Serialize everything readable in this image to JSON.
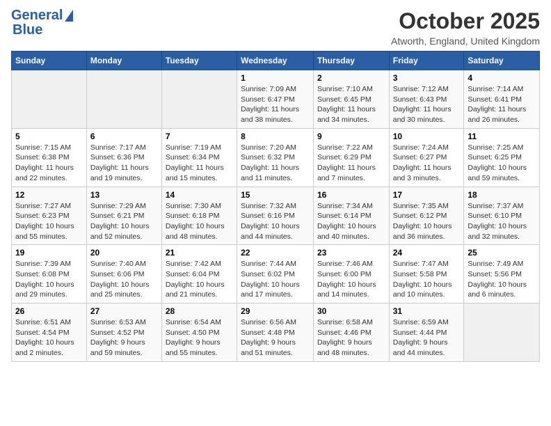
{
  "header": {
    "logo_general": "General",
    "logo_blue": "Blue",
    "month_title": "October 2025",
    "location": "Atworth, England, United Kingdom"
  },
  "weekdays": [
    "Sunday",
    "Monday",
    "Tuesday",
    "Wednesday",
    "Thursday",
    "Friday",
    "Saturday"
  ],
  "weeks": [
    [
      {
        "day": "",
        "info": ""
      },
      {
        "day": "",
        "info": ""
      },
      {
        "day": "",
        "info": ""
      },
      {
        "day": "1",
        "info": "Sunrise: 7:09 AM\nSunset: 6:47 PM\nDaylight: 11 hours\nand 38 minutes."
      },
      {
        "day": "2",
        "info": "Sunrise: 7:10 AM\nSunset: 6:45 PM\nDaylight: 11 hours\nand 34 minutes."
      },
      {
        "day": "3",
        "info": "Sunrise: 7:12 AM\nSunset: 6:43 PM\nDaylight: 11 hours\nand 30 minutes."
      },
      {
        "day": "4",
        "info": "Sunrise: 7:14 AM\nSunset: 6:41 PM\nDaylight: 11 hours\nand 26 minutes."
      }
    ],
    [
      {
        "day": "5",
        "info": "Sunrise: 7:15 AM\nSunset: 6:38 PM\nDaylight: 11 hours\nand 22 minutes."
      },
      {
        "day": "6",
        "info": "Sunrise: 7:17 AM\nSunset: 6:36 PM\nDaylight: 11 hours\nand 19 minutes."
      },
      {
        "day": "7",
        "info": "Sunrise: 7:19 AM\nSunset: 6:34 PM\nDaylight: 11 hours\nand 15 minutes."
      },
      {
        "day": "8",
        "info": "Sunrise: 7:20 AM\nSunset: 6:32 PM\nDaylight: 11 hours\nand 11 minutes."
      },
      {
        "day": "9",
        "info": "Sunrise: 7:22 AM\nSunset: 6:29 PM\nDaylight: 11 hours\nand 7 minutes."
      },
      {
        "day": "10",
        "info": "Sunrise: 7:24 AM\nSunset: 6:27 PM\nDaylight: 11 hours\nand 3 minutes."
      },
      {
        "day": "11",
        "info": "Sunrise: 7:25 AM\nSunset: 6:25 PM\nDaylight: 10 hours\nand 59 minutes."
      }
    ],
    [
      {
        "day": "12",
        "info": "Sunrise: 7:27 AM\nSunset: 6:23 PM\nDaylight: 10 hours\nand 55 minutes."
      },
      {
        "day": "13",
        "info": "Sunrise: 7:29 AM\nSunset: 6:21 PM\nDaylight: 10 hours\nand 52 minutes."
      },
      {
        "day": "14",
        "info": "Sunrise: 7:30 AM\nSunset: 6:18 PM\nDaylight: 10 hours\nand 48 minutes."
      },
      {
        "day": "15",
        "info": "Sunrise: 7:32 AM\nSunset: 6:16 PM\nDaylight: 10 hours\nand 44 minutes."
      },
      {
        "day": "16",
        "info": "Sunrise: 7:34 AM\nSunset: 6:14 PM\nDaylight: 10 hours\nand 40 minutes."
      },
      {
        "day": "17",
        "info": "Sunrise: 7:35 AM\nSunset: 6:12 PM\nDaylight: 10 hours\nand 36 minutes."
      },
      {
        "day": "18",
        "info": "Sunrise: 7:37 AM\nSunset: 6:10 PM\nDaylight: 10 hours\nand 32 minutes."
      }
    ],
    [
      {
        "day": "19",
        "info": "Sunrise: 7:39 AM\nSunset: 6:08 PM\nDaylight: 10 hours\nand 29 minutes."
      },
      {
        "day": "20",
        "info": "Sunrise: 7:40 AM\nSunset: 6:06 PM\nDaylight: 10 hours\nand 25 minutes."
      },
      {
        "day": "21",
        "info": "Sunrise: 7:42 AM\nSunset: 6:04 PM\nDaylight: 10 hours\nand 21 minutes."
      },
      {
        "day": "22",
        "info": "Sunrise: 7:44 AM\nSunset: 6:02 PM\nDaylight: 10 hours\nand 17 minutes."
      },
      {
        "day": "23",
        "info": "Sunrise: 7:46 AM\nSunset: 6:00 PM\nDaylight: 10 hours\nand 14 minutes."
      },
      {
        "day": "24",
        "info": "Sunrise: 7:47 AM\nSunset: 5:58 PM\nDaylight: 10 hours\nand 10 minutes."
      },
      {
        "day": "25",
        "info": "Sunrise: 7:49 AM\nSunset: 5:56 PM\nDaylight: 10 hours\nand 6 minutes."
      }
    ],
    [
      {
        "day": "26",
        "info": "Sunrise: 6:51 AM\nSunset: 4:54 PM\nDaylight: 10 hours\nand 2 minutes."
      },
      {
        "day": "27",
        "info": "Sunrise: 6:53 AM\nSunset: 4:52 PM\nDaylight: 9 hours\nand 59 minutes."
      },
      {
        "day": "28",
        "info": "Sunrise: 6:54 AM\nSunset: 4:50 PM\nDaylight: 9 hours\nand 55 minutes."
      },
      {
        "day": "29",
        "info": "Sunrise: 6:56 AM\nSunset: 4:48 PM\nDaylight: 9 hours\nand 51 minutes."
      },
      {
        "day": "30",
        "info": "Sunrise: 6:58 AM\nSunset: 4:46 PM\nDaylight: 9 hours\nand 48 minutes."
      },
      {
        "day": "31",
        "info": "Sunrise: 6:59 AM\nSunset: 4:44 PM\nDaylight: 9 hours\nand 44 minutes."
      },
      {
        "day": "",
        "info": ""
      }
    ]
  ]
}
